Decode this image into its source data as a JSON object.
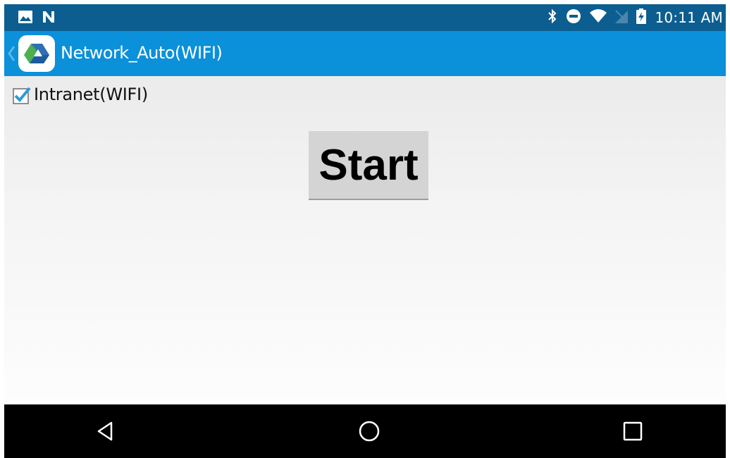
{
  "status_bar": {
    "time": "10:11 AM",
    "left_icons": [
      "image-icon",
      "n-notification-icon"
    ],
    "right_icons": [
      "bluetooth-icon",
      "do-not-disturb-icon",
      "wifi-icon",
      "no-sim-icon",
      "battery-charging-icon"
    ]
  },
  "action_bar": {
    "title": "Network_Auto(WIFI)",
    "color": "#0b90da"
  },
  "options": {
    "intranet_label": "Intranet(WIFI)",
    "intranet_checked": true
  },
  "main": {
    "start_label": "Start"
  },
  "nav_bar": {
    "buttons": [
      "back-icon",
      "home-icon",
      "recents-icon"
    ]
  },
  "colors": {
    "status_bar": "#0c5e90",
    "action_bar": "#0b90da",
    "checkbox": "#2b9ad6",
    "button": "#d4d4d4"
  }
}
